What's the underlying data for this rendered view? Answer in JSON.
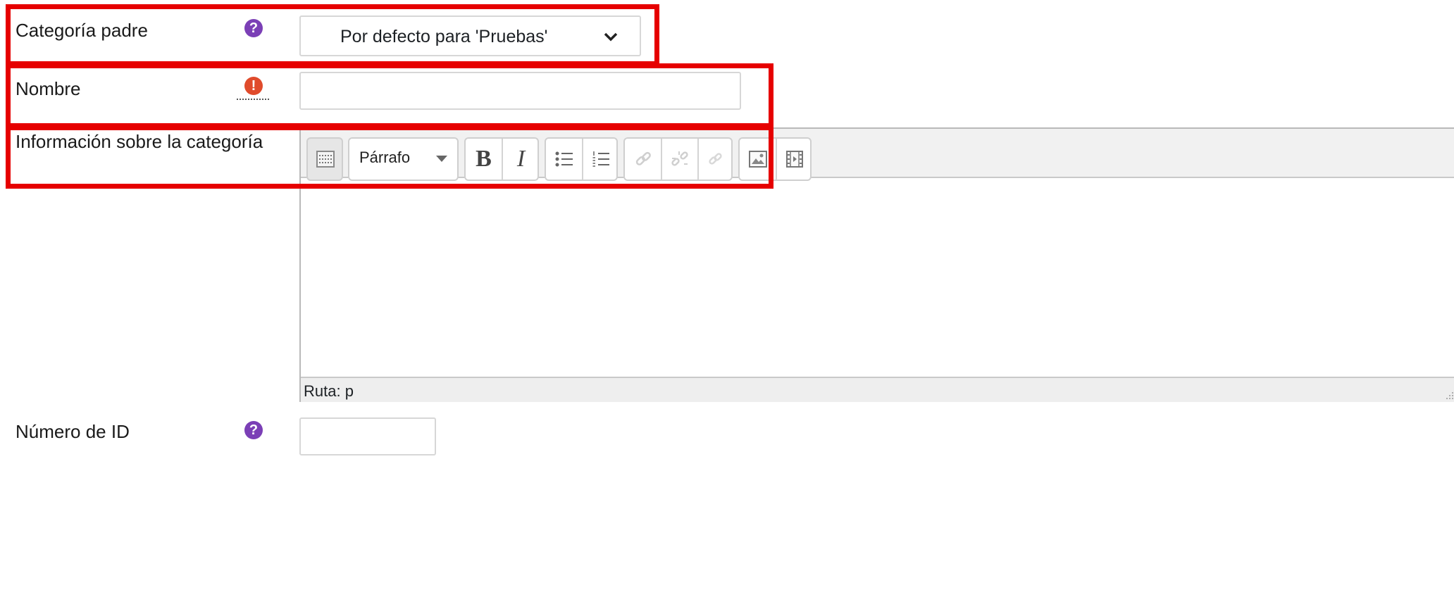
{
  "form": {
    "parent_category": {
      "label": "Categoría padre",
      "selected": "Por defecto para 'Pruebas'"
    },
    "name": {
      "label": "Nombre",
      "value": ""
    },
    "info": {
      "label": "Información sobre la categoría",
      "format_select": "Párrafo",
      "toolbar_bold": "B",
      "toolbar_italic": "I",
      "path_label": "Ruta: p"
    },
    "idnumber": {
      "label": "Número de ID",
      "value": ""
    }
  },
  "icons": {
    "help": "?",
    "required": "!"
  },
  "colors": {
    "highlight_box": "#e60000",
    "help_icon": "#7b3fb6",
    "required_icon": "#e04b2c"
  }
}
